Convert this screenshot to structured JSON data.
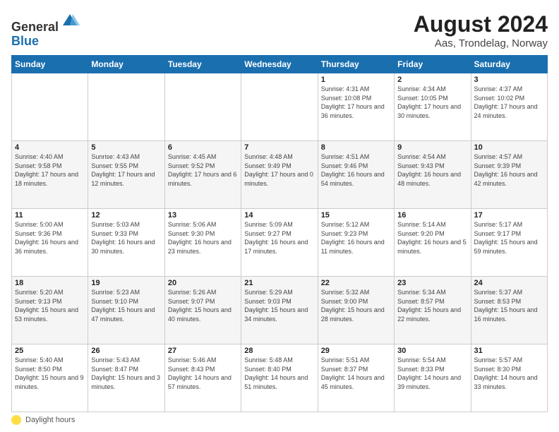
{
  "header": {
    "logo_line1": "General",
    "logo_line2": "Blue",
    "title": "August 2024",
    "subtitle": "Aas, Trondelag, Norway"
  },
  "weekdays": [
    "Sunday",
    "Monday",
    "Tuesday",
    "Wednesday",
    "Thursday",
    "Friday",
    "Saturday"
  ],
  "footer_label": "Daylight hours",
  "weeks": [
    [
      {
        "day": "",
        "content": ""
      },
      {
        "day": "",
        "content": ""
      },
      {
        "day": "",
        "content": ""
      },
      {
        "day": "",
        "content": ""
      },
      {
        "day": "1",
        "content": "Sunrise: 4:31 AM\nSunset: 10:08 PM\nDaylight: 17 hours\nand 36 minutes."
      },
      {
        "day": "2",
        "content": "Sunrise: 4:34 AM\nSunset: 10:05 PM\nDaylight: 17 hours\nand 30 minutes."
      },
      {
        "day": "3",
        "content": "Sunrise: 4:37 AM\nSunset: 10:02 PM\nDaylight: 17 hours\nand 24 minutes."
      }
    ],
    [
      {
        "day": "4",
        "content": "Sunrise: 4:40 AM\nSunset: 9:58 PM\nDaylight: 17 hours\nand 18 minutes."
      },
      {
        "day": "5",
        "content": "Sunrise: 4:43 AM\nSunset: 9:55 PM\nDaylight: 17 hours\nand 12 minutes."
      },
      {
        "day": "6",
        "content": "Sunrise: 4:45 AM\nSunset: 9:52 PM\nDaylight: 17 hours\nand 6 minutes."
      },
      {
        "day": "7",
        "content": "Sunrise: 4:48 AM\nSunset: 9:49 PM\nDaylight: 17 hours\nand 0 minutes."
      },
      {
        "day": "8",
        "content": "Sunrise: 4:51 AM\nSunset: 9:46 PM\nDaylight: 16 hours\nand 54 minutes."
      },
      {
        "day": "9",
        "content": "Sunrise: 4:54 AM\nSunset: 9:43 PM\nDaylight: 16 hours\nand 48 minutes."
      },
      {
        "day": "10",
        "content": "Sunrise: 4:57 AM\nSunset: 9:39 PM\nDaylight: 16 hours\nand 42 minutes."
      }
    ],
    [
      {
        "day": "11",
        "content": "Sunrise: 5:00 AM\nSunset: 9:36 PM\nDaylight: 16 hours\nand 36 minutes."
      },
      {
        "day": "12",
        "content": "Sunrise: 5:03 AM\nSunset: 9:33 PM\nDaylight: 16 hours\nand 30 minutes."
      },
      {
        "day": "13",
        "content": "Sunrise: 5:06 AM\nSunset: 9:30 PM\nDaylight: 16 hours\nand 23 minutes."
      },
      {
        "day": "14",
        "content": "Sunrise: 5:09 AM\nSunset: 9:27 PM\nDaylight: 16 hours\nand 17 minutes."
      },
      {
        "day": "15",
        "content": "Sunrise: 5:12 AM\nSunset: 9:23 PM\nDaylight: 16 hours\nand 11 minutes."
      },
      {
        "day": "16",
        "content": "Sunrise: 5:14 AM\nSunset: 9:20 PM\nDaylight: 16 hours\nand 5 minutes."
      },
      {
        "day": "17",
        "content": "Sunrise: 5:17 AM\nSunset: 9:17 PM\nDaylight: 15 hours\nand 59 minutes."
      }
    ],
    [
      {
        "day": "18",
        "content": "Sunrise: 5:20 AM\nSunset: 9:13 PM\nDaylight: 15 hours\nand 53 minutes."
      },
      {
        "day": "19",
        "content": "Sunrise: 5:23 AM\nSunset: 9:10 PM\nDaylight: 15 hours\nand 47 minutes."
      },
      {
        "day": "20",
        "content": "Sunrise: 5:26 AM\nSunset: 9:07 PM\nDaylight: 15 hours\nand 40 minutes."
      },
      {
        "day": "21",
        "content": "Sunrise: 5:29 AM\nSunset: 9:03 PM\nDaylight: 15 hours\nand 34 minutes."
      },
      {
        "day": "22",
        "content": "Sunrise: 5:32 AM\nSunset: 9:00 PM\nDaylight: 15 hours\nand 28 minutes."
      },
      {
        "day": "23",
        "content": "Sunrise: 5:34 AM\nSunset: 8:57 PM\nDaylight: 15 hours\nand 22 minutes."
      },
      {
        "day": "24",
        "content": "Sunrise: 5:37 AM\nSunset: 8:53 PM\nDaylight: 15 hours\nand 16 minutes."
      }
    ],
    [
      {
        "day": "25",
        "content": "Sunrise: 5:40 AM\nSunset: 8:50 PM\nDaylight: 15 hours\nand 9 minutes."
      },
      {
        "day": "26",
        "content": "Sunrise: 5:43 AM\nSunset: 8:47 PM\nDaylight: 15 hours\nand 3 minutes."
      },
      {
        "day": "27",
        "content": "Sunrise: 5:46 AM\nSunset: 8:43 PM\nDaylight: 14 hours\nand 57 minutes."
      },
      {
        "day": "28",
        "content": "Sunrise: 5:48 AM\nSunset: 8:40 PM\nDaylight: 14 hours\nand 51 minutes."
      },
      {
        "day": "29",
        "content": "Sunrise: 5:51 AM\nSunset: 8:37 PM\nDaylight: 14 hours\nand 45 minutes."
      },
      {
        "day": "30",
        "content": "Sunrise: 5:54 AM\nSunset: 8:33 PM\nDaylight: 14 hours\nand 39 minutes."
      },
      {
        "day": "31",
        "content": "Sunrise: 5:57 AM\nSunset: 8:30 PM\nDaylight: 14 hours\nand 33 minutes."
      }
    ]
  ]
}
